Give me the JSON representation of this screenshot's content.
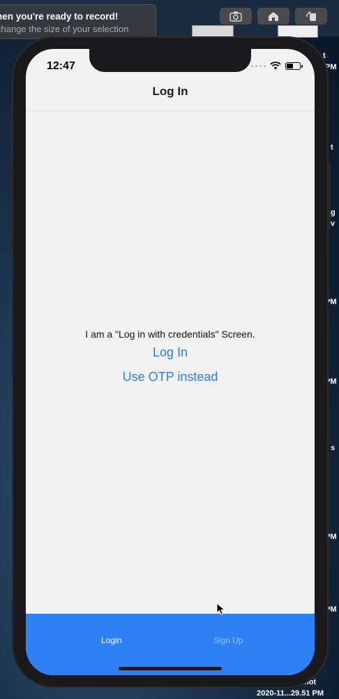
{
  "overlay": {
    "title": "hen you're ready to record!",
    "subtitle": "change the size of your selection"
  },
  "simulator_toolbar": {
    "buttons": [
      "screenshot-icon",
      "home-icon",
      "rotate-icon"
    ]
  },
  "desktop": {
    "side_labels": [
      "t",
      "PM",
      "t",
      "g",
      "v",
      "PM",
      "PM",
      "s",
      "PM",
      "PM"
    ],
    "caption_line1": "hot",
    "caption_line2": "2020-11...29.51 PM"
  },
  "status_bar": {
    "time": "12:47"
  },
  "header": {
    "title": "Log In"
  },
  "main": {
    "description": "I am a \"Log in with credentials\" Screen.",
    "login_link": "Log In",
    "otp_link": "Use OTP instead"
  },
  "tabs": [
    {
      "label": "Login",
      "active": true
    },
    {
      "label": "Sign Up",
      "active": false
    }
  ],
  "colors": {
    "tabbar": "#2f7ff5",
    "link": "#2f7de1"
  }
}
